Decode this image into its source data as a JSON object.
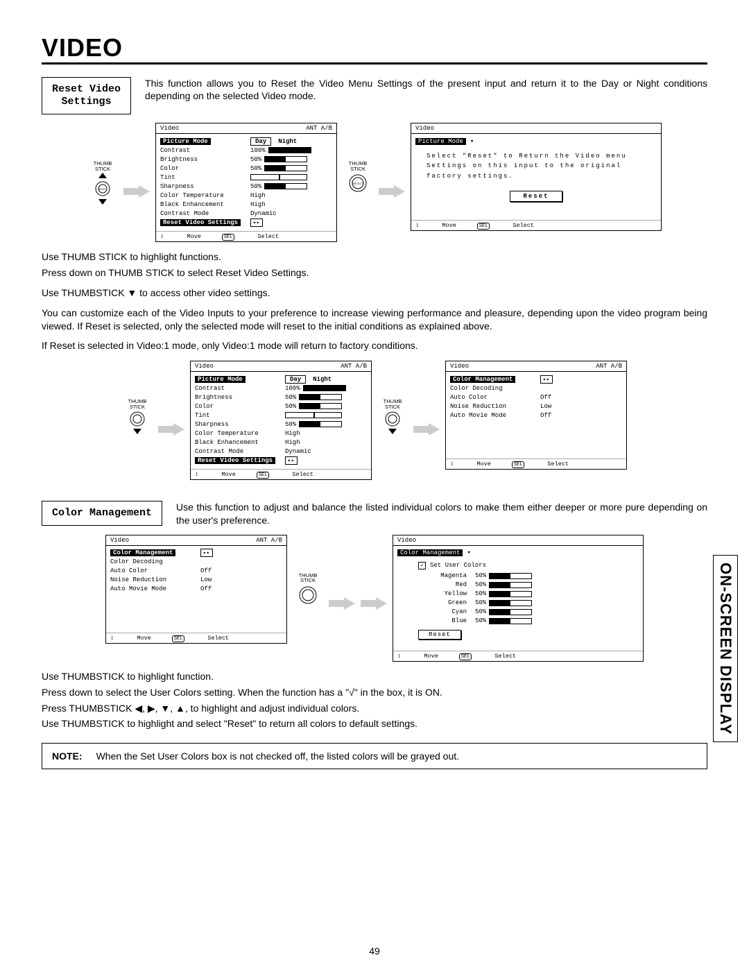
{
  "heading": "VIDEO",
  "side_label": "ON-SCREEN DISPLAY",
  "page_number": "49",
  "thumb_label": "THUMB\nSTICK",
  "select_label": "SELECT",
  "reset_section": {
    "tab": "Reset Video\nSettings",
    "intro": "This function allows you to Reset the Video Menu Settings of the present input and return it to the Day or Night conditions depending on the selected Video mode.",
    "osd1": {
      "title": "Video",
      "source": "ANT A/B",
      "rows": [
        {
          "label": "Picture Mode",
          "type": "daynight",
          "day": "Day",
          "night": "Night",
          "hi": true
        },
        {
          "label": "Contrast",
          "type": "bar",
          "text": "100%",
          "pct": 100
        },
        {
          "label": "Brightness",
          "type": "bar",
          "text": "50%",
          "pct": 50
        },
        {
          "label": "Color",
          "type": "bar",
          "text": "50%",
          "pct": 50
        },
        {
          "label": "Tint",
          "type": "tintbar"
        },
        {
          "label": "Sharpness",
          "type": "bar",
          "text": "50%",
          "pct": 50
        },
        {
          "label": "Color Temperature",
          "type": "text",
          "text": "High"
        },
        {
          "label": "Black Enhancement",
          "type": "text",
          "text": "High"
        },
        {
          "label": "Contrast Mode",
          "type": "text",
          "text": "Dynamic"
        },
        {
          "label": "Reset Video Settings",
          "type": "arrow",
          "hi": true
        }
      ],
      "foot_move": "Move",
      "foot_sel": "Select"
    },
    "osd2": {
      "title": "Video",
      "hl": "Picture Mode",
      "body_lines": "Select \"Reset\" to Return the Video menu Settings on this input to the original factory settings.",
      "reset": "Reset",
      "foot_move": "Move",
      "foot_sel": "Select"
    },
    "instructions": [
      "Use THUMB STICK to highlight functions.",
      "Press down on THUMB STICK to select Reset Video Settings.",
      "Use THUMBSTICK ▼ to access other video settings.",
      "You can customize each of the Video Inputs to your preference to increase viewing performance and pleasure, depending upon the video program being viewed. If Reset is selected, only the selected mode will reset to the initial conditions as explained above.",
      "If Reset is selected in Video:1 mode, only Video:1 mode will return to factory conditions."
    ],
    "osd3_same_as_osd1": true,
    "osd4": {
      "title": "Video",
      "source": "ANT A/B",
      "rows": [
        {
          "label": "Color Management",
          "type": "arrow",
          "hi": true
        },
        {
          "label": "Color Decoding",
          "type": "blank"
        },
        {
          "label": "Auto Color",
          "type": "text",
          "text": "Off"
        },
        {
          "label": "Noise Reduction",
          "type": "text",
          "text": "Low"
        },
        {
          "label": "Auto Movie Mode",
          "type": "text",
          "text": "Off"
        }
      ],
      "foot_move": "Move",
      "foot_sel": "Select"
    }
  },
  "color_section": {
    "tab": "Color Management",
    "intro": "Use this function to adjust and balance the listed individual colors to make them either deeper or more pure depending on the user's preference.",
    "osd5_same_as_osd4": true,
    "osd6": {
      "title": "Video",
      "hl": "Color Management",
      "set_label": "Set User Colors",
      "colors": [
        {
          "name": "Magenta",
          "text": "50%",
          "pct": 50
        },
        {
          "name": "Red",
          "text": "50%",
          "pct": 50
        },
        {
          "name": "Yellow",
          "text": "50%",
          "pct": 50
        },
        {
          "name": "Green",
          "text": "50%",
          "pct": 50
        },
        {
          "name": "Cyan",
          "text": "50%",
          "pct": 50
        },
        {
          "name": "Blue",
          "text": "50%",
          "pct": 50
        }
      ],
      "reset": "Reset",
      "foot_move": "Move",
      "foot_sel": "Select"
    },
    "instructions": [
      "Use THUMBSTICK to highlight function.",
      "Press down to select the User Colors setting.  When the function has a \"√\" in the box, it is ON.",
      "Press THUMBSTICK ◀, ▶, ▼, ▲, to highlight and adjust individual colors.",
      "Use THUMBSTICK to highlight and select \"Reset\" to return all colors to default settings."
    ]
  },
  "note": {
    "label": "NOTE:",
    "text": "When the Set User Colors box is not checked off, the listed colors will be grayed out."
  }
}
